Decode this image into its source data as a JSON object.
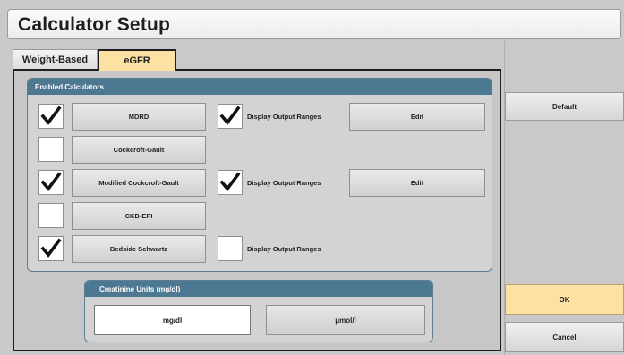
{
  "window": {
    "title": "Calculator Setup"
  },
  "tabs": [
    {
      "label": "Weight-Based",
      "active": false
    },
    {
      "label": "eGFR",
      "active": true
    }
  ],
  "enabled_calculators": {
    "header": "Enabled Calculators",
    "rows": [
      {
        "name": "MDRD",
        "enabled": true,
        "display_output_ranges": true,
        "show_ranges_option": true,
        "edit_label": "Edit"
      },
      {
        "name": "Cockcroft-Gault",
        "enabled": false,
        "show_ranges_option": false
      },
      {
        "name": "Modified Cockcroft-Gault",
        "enabled": true,
        "display_output_ranges": true,
        "show_ranges_option": true,
        "edit_label": "Edit"
      },
      {
        "name": "CKD-EPI",
        "enabled": false,
        "show_ranges_option": false
      },
      {
        "name": "Bedside Schwartz",
        "enabled": true,
        "display_output_ranges": false,
        "show_ranges_option": true
      }
    ],
    "display_output_ranges_label": "Display Output Ranges"
  },
  "creatinine_units": {
    "header": "Creatinine Units   (mg/dl)",
    "options": [
      "mg/dl",
      "μmol/l"
    ],
    "selected": "mg/dl"
  },
  "side_buttons": {
    "default_label": "Default",
    "ok_label": "OK",
    "cancel_label": "Cancel"
  },
  "colors": {
    "accent": "#fde1a2",
    "group_header": "#4d7891",
    "background": "#c9c9c9"
  },
  "icons": {
    "check": "check-icon"
  }
}
